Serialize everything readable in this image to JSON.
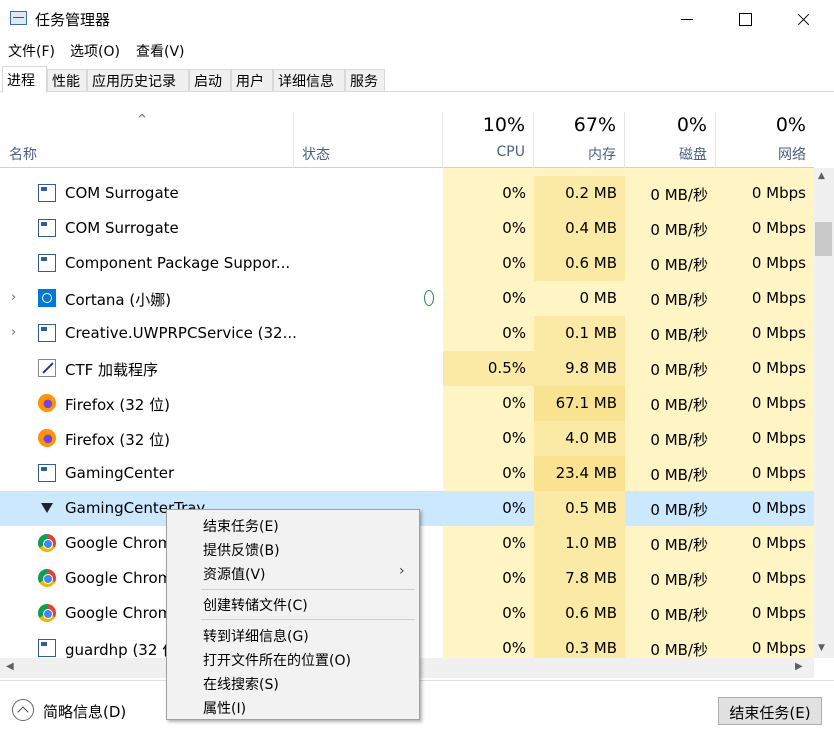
{
  "window": {
    "title": "任务管理器"
  },
  "menu": [
    "文件(F)",
    "选项(O)",
    "查看(V)"
  ],
  "tabs": [
    "进程",
    "性能",
    "应用历史记录",
    "启动",
    "用户",
    "详细信息",
    "服务"
  ],
  "header": {
    "name": "名称",
    "status": "状态",
    "cpu_pct": "10%",
    "cpu": "CPU",
    "mem_pct": "67%",
    "mem": "内存",
    "disk_pct": "0%",
    "disk": "磁盘",
    "net_pct": "0%",
    "net": "网络"
  },
  "rows": [
    {
      "name": "COM Surrogate",
      "icon": "box",
      "cpu": "0%",
      "mem": "0.2 MB",
      "disk": "0 MB/秒",
      "net": "0 Mbps"
    },
    {
      "name": "COM Surrogate",
      "icon": "box",
      "cpu": "0%",
      "mem": "0.4 MB",
      "disk": "0 MB/秒",
      "net": "0 Mbps"
    },
    {
      "name": "Component Package Suppor...",
      "icon": "box",
      "cpu": "0%",
      "mem": "0.6 MB",
      "disk": "0 MB/秒",
      "net": "0 Mbps"
    },
    {
      "name": "Cortana (小娜)",
      "icon": "cortana",
      "cpu": "0%",
      "mem": "0 MB",
      "disk": "0 MB/秒",
      "net": "0 Mbps"
    },
    {
      "name": "Creative.UWPRPCService (32...",
      "icon": "box",
      "cpu": "0%",
      "mem": "0.1 MB",
      "disk": "0 MB/秒",
      "net": "0 Mbps"
    },
    {
      "name": "CTF 加载程序",
      "icon": "ctf",
      "cpu": "0.5%",
      "mem": "9.8 MB",
      "disk": "0 MB/秒",
      "net": "0 Mbps"
    },
    {
      "name": "Firefox (32 位)",
      "icon": "firefox",
      "cpu": "0%",
      "mem": "67.1 MB",
      "disk": "0 MB/秒",
      "net": "0 Mbps"
    },
    {
      "name": "Firefox (32 位)",
      "icon": "firefox",
      "cpu": "0%",
      "mem": "4.0 MB",
      "disk": "0 MB/秒",
      "net": "0 Mbps"
    },
    {
      "name": "GamingCenter",
      "icon": "box",
      "cpu": "0%",
      "mem": "23.4 MB",
      "disk": "0 MB/秒",
      "net": "0 Mbps"
    },
    {
      "name": "GamingCenterTray",
      "icon": "tray",
      "cpu": "0%",
      "mem": "0.5 MB",
      "disk": "0 MB/秒",
      "net": "0 Mbps"
    },
    {
      "name": "Google Chrome",
      "icon": "chrome",
      "cpu": "0%",
      "mem": "1.0 MB",
      "disk": "0 MB/秒",
      "net": "0 Mbps"
    },
    {
      "name": "Google Chrome",
      "icon": "chrome",
      "cpu": "0%",
      "mem": "7.8 MB",
      "disk": "0 MB/秒",
      "net": "0 Mbps"
    },
    {
      "name": "Google Chrome",
      "icon": "chrome",
      "cpu": "0%",
      "mem": "0.6 MB",
      "disk": "0 MB/秒",
      "net": "0 Mbps"
    },
    {
      "name": "guardhp (32 位)",
      "icon": "box",
      "cpu": "0%",
      "mem": "0.3 MB",
      "disk": "0 MB/秒",
      "net": "0 Mbps"
    }
  ],
  "context_menu": {
    "end_task": "结束任务(E)",
    "feedback": "提供反馈(B)",
    "resource_values": "资源值(V)",
    "create_dump": "创建转储文件(C)",
    "go_to_details": "转到详细信息(G)",
    "open_location": "打开文件所在的位置(O)",
    "search_online": "在线搜索(S)",
    "properties": "属性(I)"
  },
  "footer": {
    "brief": "简略信息(D)",
    "end_task": "结束任务(E)"
  }
}
